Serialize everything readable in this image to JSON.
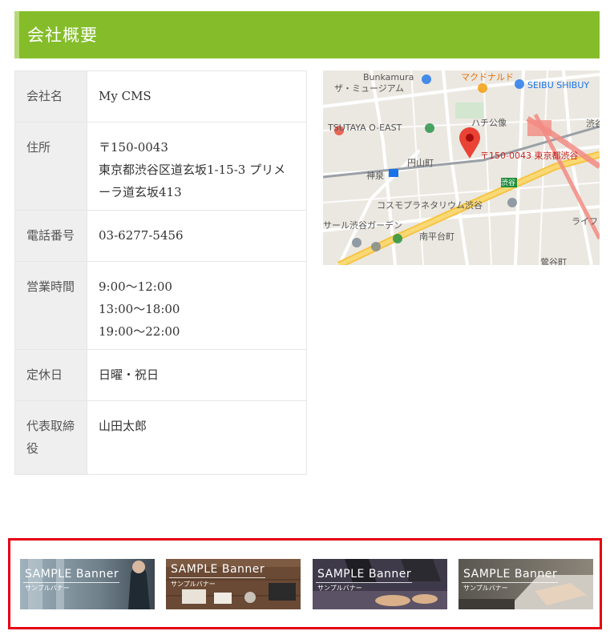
{
  "section": {
    "title": "会社概要"
  },
  "company_table": {
    "rows": [
      {
        "label": "会社名",
        "value_lines": [
          "My CMS"
        ]
      },
      {
        "label": "住所",
        "value_lines": [
          "〒150-0043",
          "東京都渋谷区道玄坂1-15-3 プリメ",
          "ーラ道玄坂413"
        ]
      },
      {
        "label": "電話番号",
        "value_lines": [
          "03-6277-5456"
        ]
      },
      {
        "label": "営業時間",
        "value_lines": [
          "9:00～12:00",
          "13:00～18:00",
          "19:00～22:00"
        ]
      },
      {
        "label": "定休日",
        "value_lines": [
          "日曜・祝日"
        ]
      },
      {
        "label_lines": [
          "代表取締",
          "役"
        ],
        "value_lines": [
          "山田太郎"
        ]
      }
    ]
  },
  "map": {
    "labels": {
      "bunkamura": "Bunkamura",
      "museum": "ザ・ミュージアム",
      "mcdonalds": "マクドナルド",
      "seibu": "SEIBU SHIBUY",
      "tsutaya": "TSUTAYA O-EAST",
      "hachiko": "ハチ公像",
      "shibuya_right": "渋谷",
      "marker": "〒150-0043 東京都渋谷",
      "maruyama": "円山町",
      "shinsen": "神泉",
      "shibuya_sign": "渋谷",
      "planetarium": "コスモプラネタリウム渋谷",
      "garden": "サール渋谷ガーデン",
      "nanpeidai": "南平台町",
      "uguisudani": "鶯谷町",
      "life": "ライフ"
    },
    "colors": {
      "marker": "#ea4335",
      "road_major": "#f6c443",
      "rail": "#f28b82"
    }
  },
  "banners": [
    {
      "title": "SAMPLE Banner",
      "subtitle": "サンプルバナー"
    },
    {
      "title": "SAMPLE Banner",
      "subtitle": "サンプルバナー"
    },
    {
      "title": "SAMPLE Banner",
      "subtitle": "サンプルバナー"
    },
    {
      "title": "SAMPLE Banner",
      "subtitle": "サンプルバナー"
    }
  ],
  "colors": {
    "header_bg": "#85bd2a",
    "highlight_border": "#e60012"
  }
}
